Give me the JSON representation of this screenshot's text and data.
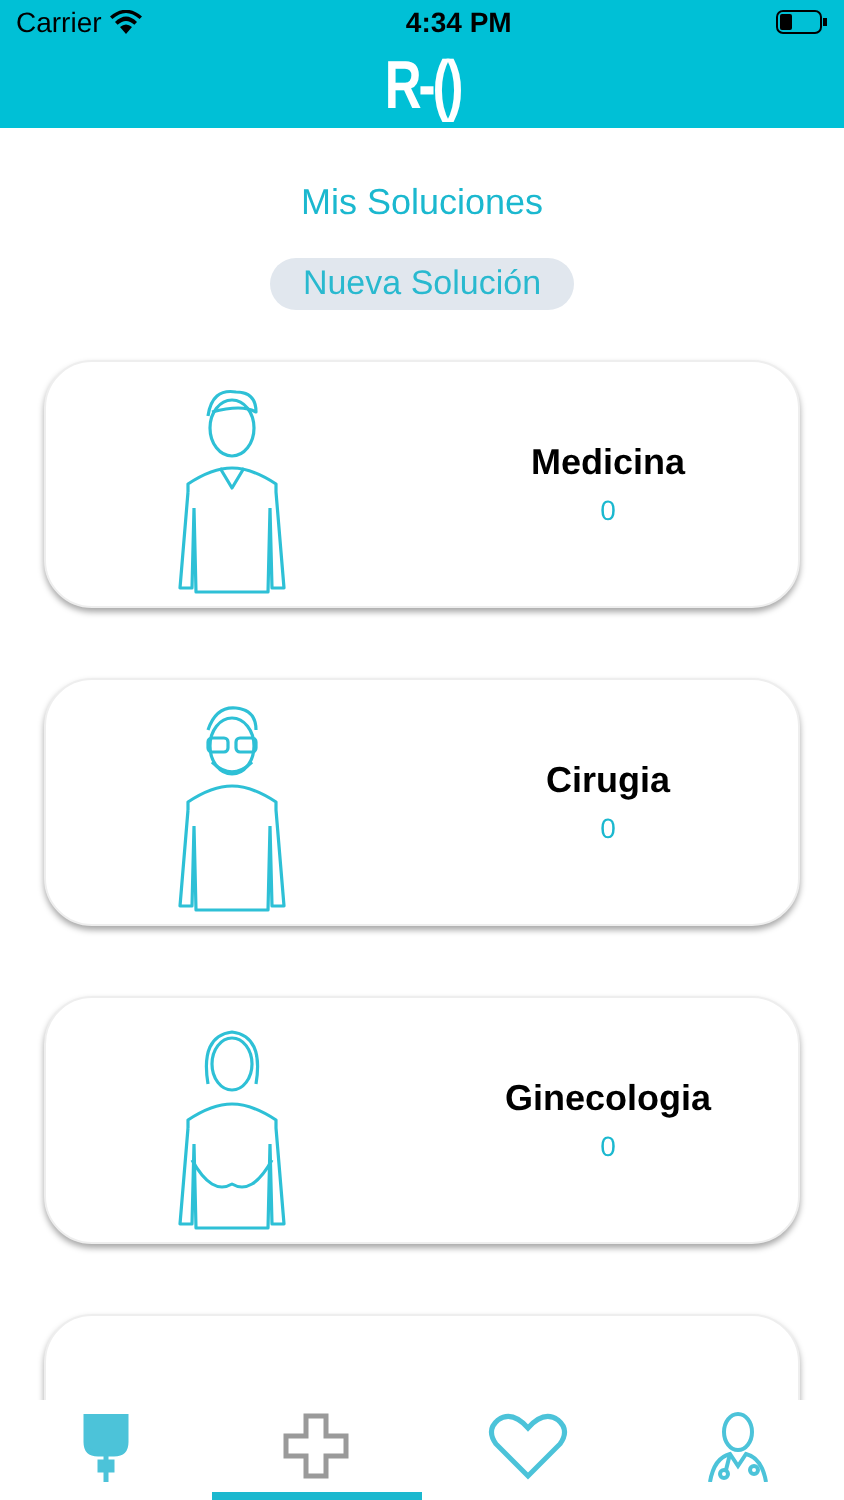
{
  "status_bar": {
    "carrier": "Carrier",
    "time": "4:34 PM"
  },
  "header": {
    "logo": "R-()"
  },
  "title": "Mis Soluciones",
  "new_button": "Nueva Solución",
  "cards": [
    {
      "kind": "man",
      "name": "Medicina",
      "count": "0"
    },
    {
      "kind": "glasses",
      "name": "Cirugia",
      "count": "0"
    },
    {
      "kind": "woman",
      "name": "Ginecologia",
      "count": "0"
    }
  ],
  "tabs": [
    {
      "kind": "iv",
      "selected": false
    },
    {
      "kind": "cross",
      "selected": true
    },
    {
      "kind": "heart",
      "selected": false
    },
    {
      "kind": "doctor",
      "selected": false
    }
  ]
}
